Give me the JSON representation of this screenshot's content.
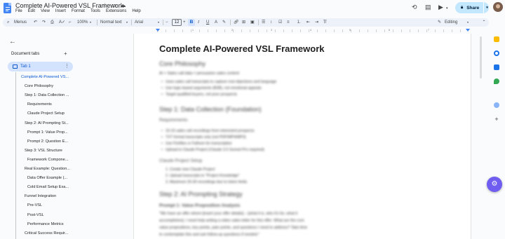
{
  "window": {
    "title": "Complete AI-Powered VSL Framework",
    "menu": [
      "File",
      "Edit",
      "View",
      "Insert",
      "Format",
      "Tools",
      "Extensions",
      "Help"
    ],
    "share_label": "Share"
  },
  "toolbar": {
    "menus_label": "Menus",
    "zoom": "100%",
    "style": "Normal text",
    "font": "Arial",
    "font_size": "12",
    "bold": "B",
    "italic": "I",
    "underline": "U",
    "text_color": "A",
    "minus": "−",
    "plus": "+",
    "mode": "Editing"
  },
  "ruler": {
    "labels": [
      "1",
      "2",
      "3",
      "4",
      "5",
      "6",
      "7"
    ]
  },
  "sidebar": {
    "header": "Document tabs",
    "tab_label": "Tab 1",
    "outline": [
      {
        "label": "Complete AI-Powered VS...",
        "level": 1,
        "active": true
      },
      {
        "label": "Core Philosophy",
        "level": 2
      },
      {
        "label": "Step 1: Data Collection ...",
        "level": 2
      },
      {
        "label": "Requirements",
        "level": 3
      },
      {
        "label": "Claude Project Setup",
        "level": 3
      },
      {
        "label": "Step 2: AI Prompting St...",
        "level": 2
      },
      {
        "label": "Prompt 1: Value Prop...",
        "level": 3
      },
      {
        "label": "Prompt 2: Question E...",
        "level": 3
      },
      {
        "label": "Step 3: VSL Structure",
        "level": 2
      },
      {
        "label": "Framework Compone...",
        "level": 3
      },
      {
        "label": "Real Example: Question...",
        "level": 2
      },
      {
        "label": "Data Offer Example (...",
        "level": 3
      },
      {
        "label": "Cold Email Setup Exa...",
        "level": 3
      },
      {
        "label": "Funnel Integration",
        "level": 2
      },
      {
        "label": "Pre-VSL",
        "level": 3
      },
      {
        "label": "Post-VSL",
        "level": 3
      },
      {
        "label": "Performance Metrics",
        "level": 3
      },
      {
        "label": "Critical Success Requir...",
        "level": 2
      }
    ]
  },
  "document": {
    "title": "Complete AI-Powered VSL Framework",
    "h_core": "Core Philosophy",
    "p_core": "AI + Sales call data = persuasive sales content",
    "core_bullets": [
      "Uses sales call transcripts to capture real objections and language",
      "Use logic-based arguments (B2B), not emotional appeals",
      "Target qualified buyers, not poor prospects"
    ],
    "h_step1": "Step 1: Data Collection (Foundation)",
    "sub_req": "Requirements",
    "req_bullets": [
      "10-15 sales call recordings from interested prospects",
      "TXT format transcripts only (not PDF/MP4/MP3)",
      "Use Fireflies or Fathom for transcription",
      "Upload to Claude Project (Claude 3.5 Sonnet Pro required)"
    ],
    "sub_setup": "Claude Project Setup",
    "setup_steps": [
      "1. Create new Claude Project",
      "2. Upload transcripts to \"Project Knowledge\"",
      "3. Maximum 20-30 recordings due to token limits"
    ],
    "h_step2": "Step 2: AI Prompting Strategy",
    "sub_p1": "Prompt 1: Value Proposition Analysis",
    "p1_lines": [
      "\"We have an offer where [insert your offer details] – [what it is, who it's for, what it",
      "accomplishes]. I need help writing a video sales letter for this offer. What are the core",
      "value propositions, key points, pain points, and questions I need to address? Take time",
      "to contemplate this and ask follow-up questions if needed.\""
    ]
  }
}
